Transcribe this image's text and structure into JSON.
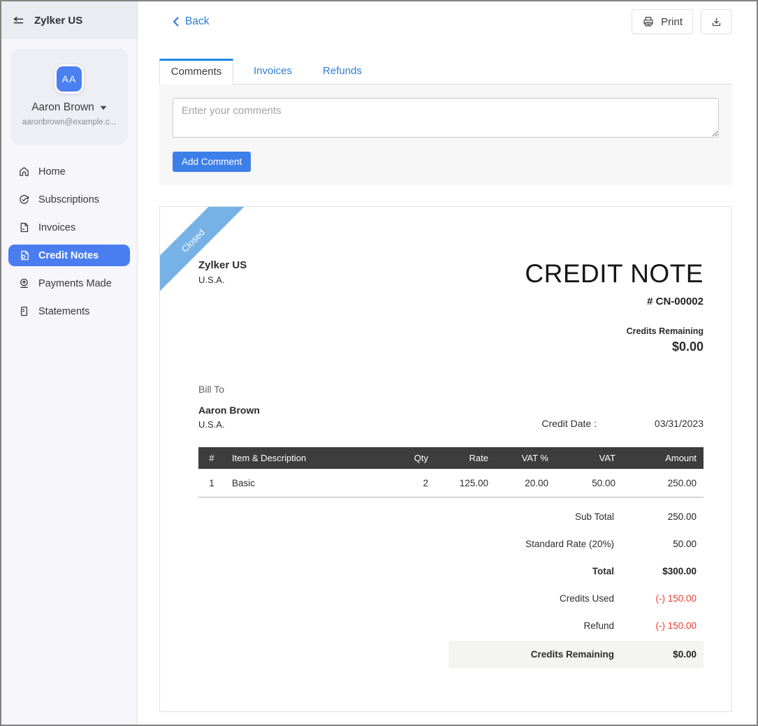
{
  "sidebar": {
    "title": "Zylker US",
    "toggle_icon": "collapse-sidebar-icon",
    "profile": {
      "initials": "AA",
      "name": "Aaron Brown",
      "caret_icon": "caret-down-icon",
      "email": "aaronbrown@example.c..."
    },
    "items": [
      {
        "label": "Home",
        "icon": "home-icon",
        "active": false
      },
      {
        "label": "Subscriptions",
        "icon": "subscriptions-icon",
        "active": false
      },
      {
        "label": "Invoices",
        "icon": "invoice-icon",
        "active": false
      },
      {
        "label": "Credit Notes",
        "icon": "credit-note-icon",
        "active": true
      },
      {
        "label": "Payments Made",
        "icon": "payments-made-icon",
        "active": false
      },
      {
        "label": "Statements",
        "icon": "statements-icon",
        "active": false
      }
    ]
  },
  "toolbar": {
    "back_label": "Back",
    "back_icon": "chevron-left-icon",
    "print_label": "Print",
    "print_icon": "printer-icon",
    "download_icon": "download-icon"
  },
  "tabs": [
    {
      "label": "Comments",
      "active": true
    },
    {
      "label": "Invoices",
      "active": false
    },
    {
      "label": "Refunds",
      "active": false
    }
  ],
  "comments": {
    "placeholder": "Enter your comments",
    "add_button_label": "Add Comment"
  },
  "credit_note": {
    "ribbon": "Closed",
    "company": "Zylker US",
    "company_country": "U.S.A.",
    "doc_title": "CREDIT NOTE",
    "doc_number": "# CN-00002",
    "credits_remaining_label": "Credits Remaining",
    "credits_remaining_value": "$0.00",
    "bill_to_label": "Bill To",
    "bill_to_name": "Aaron Brown",
    "bill_to_country": "U.S.A.",
    "credit_date_label": "Credit Date :",
    "credit_date_value": "03/31/2023",
    "table": {
      "headers": [
        "#",
        "Item & Description",
        "Qty",
        "Rate",
        "VAT %",
        "VAT",
        "Amount"
      ],
      "rows": [
        [
          "1",
          "Basic",
          "2",
          "125.00",
          "20.00",
          "50.00",
          "250.00"
        ]
      ]
    },
    "totals": [
      {
        "label": "Sub Total",
        "value": "250.00"
      },
      {
        "label": "Standard Rate (20%)",
        "value": "50.00"
      },
      {
        "label": "Total",
        "value": "$300.00"
      },
      {
        "label": "Credits Used",
        "value": "(-) 150.00"
      },
      {
        "label": "Refund",
        "value": "(-) 150.00"
      },
      {
        "label": "Credits Remaining",
        "value": "$0.00"
      }
    ]
  },
  "colors": {
    "accent_blue": "#4a7df0",
    "avatar_blue": "#4a80f0",
    "link_blue": "#2d7dd9",
    "tab_accent": "#1f87e8",
    "button_blue": "#3d7fe9",
    "ribbon_blue": "#76b2e5",
    "table_header_bg": "#3d3d3d",
    "negative_red": "#ef3b2d",
    "sidebar_bg": "#f6f6fb",
    "panel_bg": "#f7f7f7"
  }
}
